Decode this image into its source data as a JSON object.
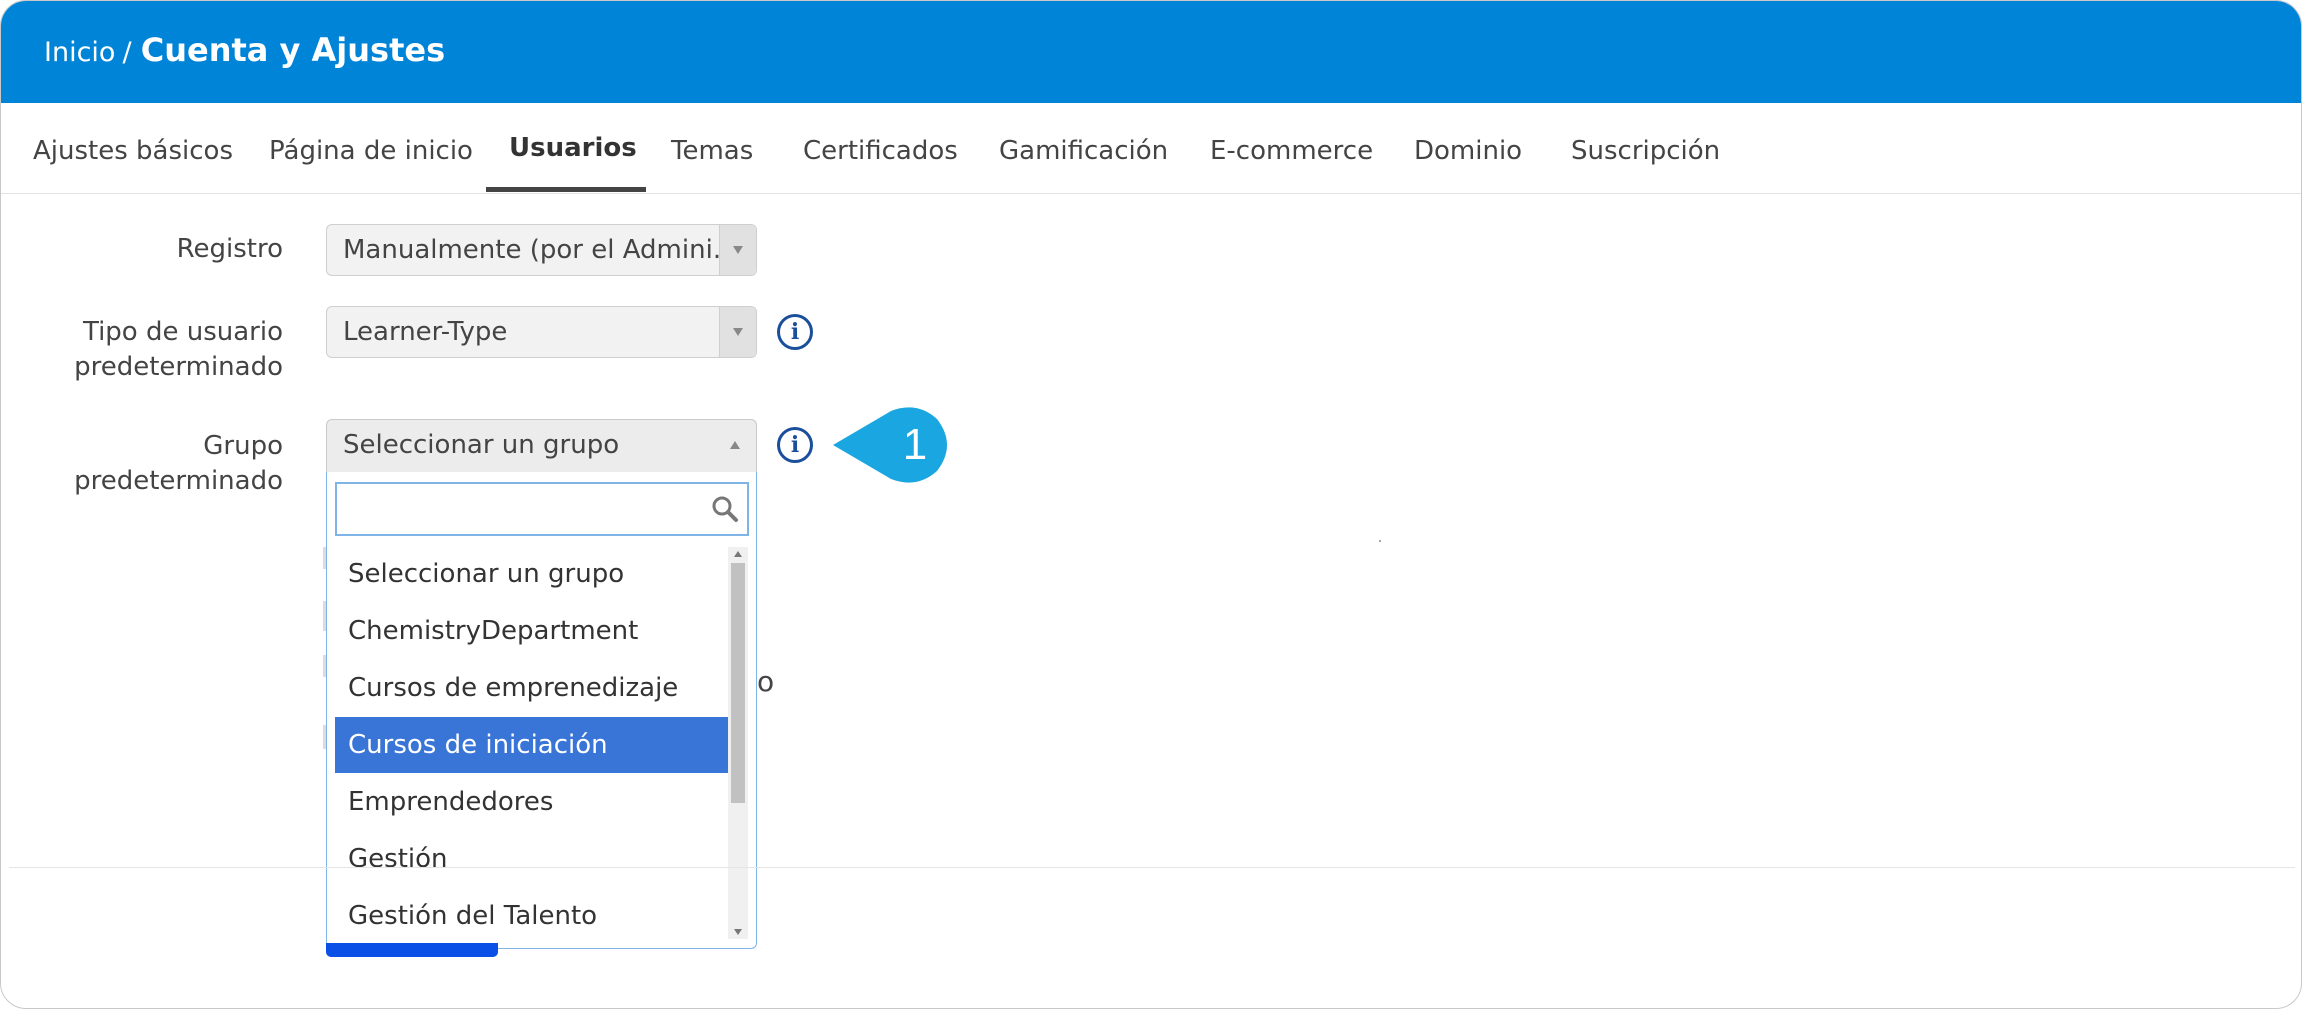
{
  "header": {
    "breadcrumb_home": "Inicio",
    "breadcrumb_sep": "/",
    "page_title": "Cuenta y Ajustes",
    "color": "#0084d8"
  },
  "tabs": [
    {
      "label": "Ajustes básicos"
    },
    {
      "label": "Página de inicio"
    },
    {
      "label": "Usuarios",
      "active": true
    },
    {
      "label": "Temas"
    },
    {
      "label": "Certificados"
    },
    {
      "label": "Gamificación"
    },
    {
      "label": "E-commerce"
    },
    {
      "label": "Dominio"
    },
    {
      "label": "Suscripción"
    }
  ],
  "form": {
    "registro": {
      "label": "Registro",
      "value": "Manualmente (por el Admini..."
    },
    "tipo_usuario": {
      "label_line1": "Tipo de usuario",
      "label_line2": "predeterminado",
      "value": "Learner-Type"
    },
    "grupo": {
      "label_line1": "Grupo",
      "label_line2": "predeterminado",
      "value": "Seleccionar un grupo",
      "search_value": "",
      "options": [
        "Seleccionar un grupo",
        "ChemistryDepartment",
        "Cursos de emprenedizaje",
        "Cursos de iniciación",
        "Emprendedores",
        "Gestión",
        "Gestión del Talento"
      ],
      "highlighted_option": "Cursos de iniciación"
    }
  },
  "icons": {
    "info": "info-circle-icon",
    "search": "search-icon",
    "dropdown_arrow": "chevron-down-icon"
  },
  "callout": {
    "number": "1",
    "color": "#1aa6e0"
  },
  "partial_text": "o",
  "highlight_color": "#3875d7"
}
